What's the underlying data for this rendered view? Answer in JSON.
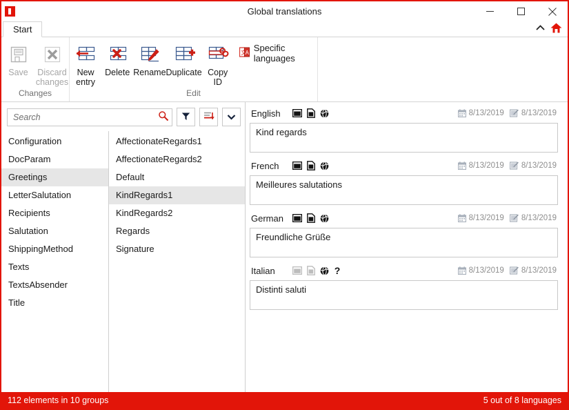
{
  "window": {
    "title": "Global translations",
    "app_icon": "app-logo-icon",
    "accent_color": "#e21509",
    "controls": [
      {
        "name": "minimize-button",
        "glyph": "minimize-icon"
      },
      {
        "name": "maximize-button",
        "glyph": "maximize-icon"
      },
      {
        "name": "close-button",
        "glyph": "close-icon"
      }
    ]
  },
  "ribbon": {
    "tabs": [
      {
        "label": "Start",
        "active": true
      }
    ],
    "collapse_label": "collapse-ribbon-icon",
    "home_label": "home-icon",
    "groups": [
      {
        "label": "Changes",
        "buttons": [
          {
            "label": "Save",
            "icon": "save-floppy-icon",
            "disabled": true
          },
          {
            "label": "Discard\nchanges",
            "icon": "discard-changes-icon",
            "disabled": true
          }
        ]
      },
      {
        "label": "Edit",
        "buttons": [
          {
            "label": "New\nentry",
            "icon": "new-entry-icon",
            "disabled": false
          },
          {
            "label": "Delete",
            "icon": "delete-icon",
            "disabled": false
          },
          {
            "label": "Rename",
            "icon": "rename-icon",
            "disabled": false
          },
          {
            "label": "Duplicate",
            "icon": "duplicate-icon",
            "disabled": false
          },
          {
            "label": "Copy\nID",
            "icon": "copy-id-icon",
            "disabled": false
          }
        ],
        "small_buttons": [
          {
            "label": "Specific languages",
            "icon": "specific-languages-icon"
          }
        ]
      }
    ]
  },
  "search": {
    "value": "",
    "placeholder": "Search",
    "icon": "search-icon",
    "buttons": [
      {
        "name": "filter-button",
        "icon": "filter-funnel-icon"
      },
      {
        "name": "sort-button",
        "icon": "sort-descending-icon"
      },
      {
        "name": "more-options-button",
        "icon": "chevron-down-icon"
      }
    ]
  },
  "groups_list": {
    "items": [
      {
        "label": "Configuration",
        "selected": false
      },
      {
        "label": "DocParam",
        "selected": false
      },
      {
        "label": "Greetings",
        "selected": true
      },
      {
        "label": "LetterSalutation",
        "selected": false
      },
      {
        "label": "Recipients",
        "selected": false
      },
      {
        "label": "Salutation",
        "selected": false
      },
      {
        "label": "ShippingMethod",
        "selected": false
      },
      {
        "label": "Texts",
        "selected": false
      },
      {
        "label": "TextsAbsender",
        "selected": false
      },
      {
        "label": "Title",
        "selected": false
      }
    ]
  },
  "entries_list": {
    "items": [
      {
        "label": "AffectionateRegards1",
        "selected": false
      },
      {
        "label": "AffectionateRegards2",
        "selected": false
      },
      {
        "label": "Default",
        "selected": false
      },
      {
        "label": "KindRegards1",
        "selected": true
      },
      {
        "label": "KindRegards2",
        "selected": false
      },
      {
        "label": "Regards",
        "selected": false
      },
      {
        "label": "Signature",
        "selected": false
      }
    ]
  },
  "translations": [
    {
      "language": "English",
      "text": "Kind regards",
      "created_date": "8/13/2019",
      "modified_date": "8/13/2019",
      "icons": [
        {
          "name": "window-icon",
          "dimmed": false
        },
        {
          "name": "document-icon",
          "dimmed": false
        },
        {
          "name": "globe-icon",
          "dimmed": false
        }
      ]
    },
    {
      "language": "French",
      "text": "Meilleures salutations",
      "created_date": "8/13/2019",
      "modified_date": "8/13/2019",
      "icons": [
        {
          "name": "window-icon",
          "dimmed": false
        },
        {
          "name": "document-icon",
          "dimmed": false
        },
        {
          "name": "globe-icon",
          "dimmed": false
        }
      ]
    },
    {
      "language": "German",
      "text": "Freundliche Grüße",
      "created_date": "8/13/2019",
      "modified_date": "8/13/2019",
      "icons": [
        {
          "name": "window-icon",
          "dimmed": false
        },
        {
          "name": "document-icon",
          "dimmed": false
        },
        {
          "name": "globe-icon",
          "dimmed": false
        }
      ]
    },
    {
      "language": "Italian",
      "text": "Distinti saluti",
      "created_date": "8/13/2019",
      "modified_date": "8/13/2019",
      "icons": [
        {
          "name": "window-icon",
          "dimmed": true
        },
        {
          "name": "document-icon",
          "dimmed": true
        },
        {
          "name": "globe-icon",
          "dimmed": false
        },
        {
          "name": "help-question-icon",
          "dimmed": false
        }
      ]
    }
  ],
  "statusbar": {
    "left": "112 elements in 10 groups",
    "right": "5 out of 8 languages"
  }
}
